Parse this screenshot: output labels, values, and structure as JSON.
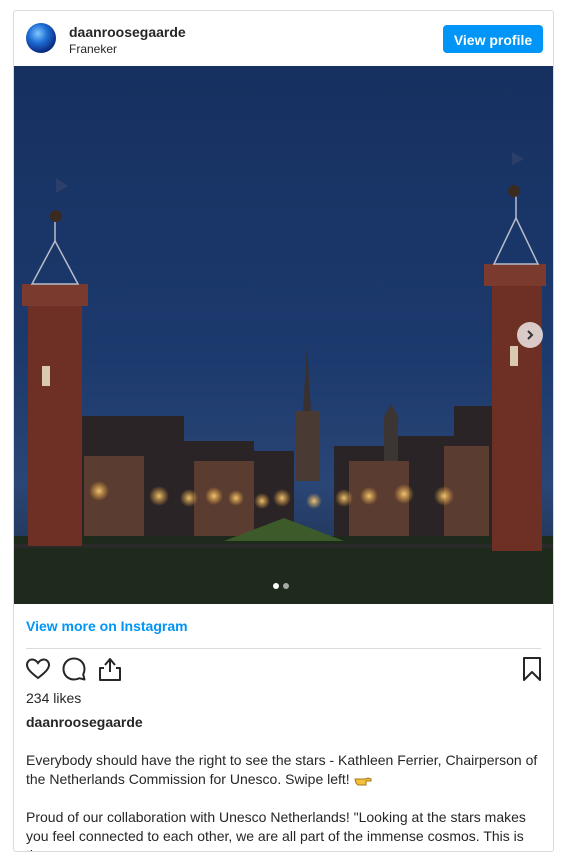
{
  "header": {
    "username": "daanroosegaarde",
    "location": "Franeker",
    "view_profile_label": "View profile"
  },
  "carousel": {
    "current_index": 1,
    "total": 2
  },
  "view_more_label": "View more on Instagram",
  "likes_text": "234 likes",
  "caption": {
    "username": "daanroosegaarde",
    "paragraph1": "Everybody should have the right to see the stars - Kathleen Ferrier, Chairperson of the Netherlands Commission for Unesco. Swipe left!",
    "paragraph2": "Proud of our collaboration with Unesco Netherlands! \"Looking at the stars makes you feel connected to each other, we are all part of the immense cosmos. This is the"
  },
  "icons": {
    "avatar": "avatar-image",
    "next": "chevron-right-icon",
    "like": "heart-icon",
    "comment": "comment-icon",
    "share": "share-icon",
    "save": "bookmark-icon",
    "caption_emoji": "pointing-hand-icon"
  },
  "colors": {
    "accent": "#0095f6",
    "border": "#dbdbdb",
    "text": "#262626",
    "sky": "#1b3566"
  }
}
